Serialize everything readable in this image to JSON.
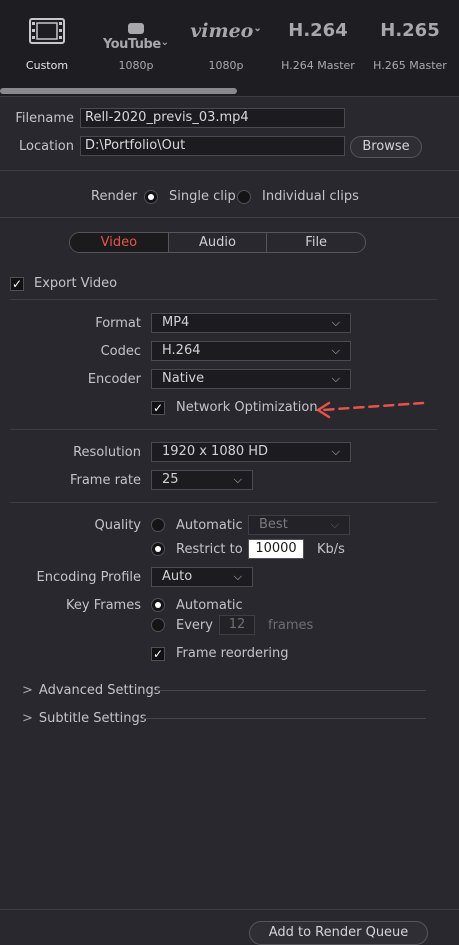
{
  "presets": [
    {
      "name": "Custom",
      "icon": "film-icon",
      "selected": true
    },
    {
      "name": "1080p",
      "brand": "YouTube",
      "icon": "youtube-icon"
    },
    {
      "name": "1080p",
      "brand": "vimeo",
      "icon": "vimeo-icon"
    },
    {
      "name": "H.264 Master",
      "brand": "H.264",
      "icon": "h264-icon"
    },
    {
      "name": "H.265 Master",
      "brand": "H.265",
      "icon": "h265-icon"
    }
  ],
  "file": {
    "filename_label": "Filename",
    "filename_value": "Rell-2020_previs_03.mp4",
    "location_label": "Location",
    "location_value": "D:\\Portfolio\\Out",
    "browse_label": "Browse"
  },
  "render": {
    "label": "Render",
    "single_clip": "Single clip",
    "individual_clips": "Individual clips",
    "selected": "single_clip"
  },
  "tabs": [
    {
      "label": "Video",
      "active": true
    },
    {
      "label": "Audio",
      "active": false
    },
    {
      "label": "File",
      "active": false
    }
  ],
  "video": {
    "export_label": "Export Video",
    "export_checked": true,
    "format_label": "Format",
    "format_value": "MP4",
    "codec_label": "Codec",
    "codec_value": "H.264",
    "encoder_label": "Encoder",
    "encoder_value": "Native",
    "network_opt_label": "Network Optimization",
    "network_opt_checked": true,
    "resolution_label": "Resolution",
    "resolution_value": "1920 x 1080 HD",
    "framerate_label": "Frame rate",
    "framerate_value": "25",
    "quality_label": "Quality",
    "quality_auto": "Automatic",
    "quality_auto_value": "Best",
    "quality_restrict": "Restrict to",
    "quality_restrict_value": "10000",
    "quality_unit": "Kb/s",
    "profile_label": "Encoding Profile",
    "profile_value": "Auto",
    "keyframes_label": "Key Frames",
    "keyframes_auto": "Automatic",
    "keyframes_every": "Every",
    "keyframes_every_value": "12",
    "keyframes_unit": "frames",
    "reorder_label": "Frame reordering",
    "reorder_checked": true
  },
  "sections": {
    "advanced": "Advanced Settings",
    "subtitle": "Subtitle Settings"
  },
  "footer": {
    "add_queue": "Add to Render Queue"
  },
  "colors": {
    "accent": "#e8524b",
    "annotation_arrow": "#e8524b"
  }
}
